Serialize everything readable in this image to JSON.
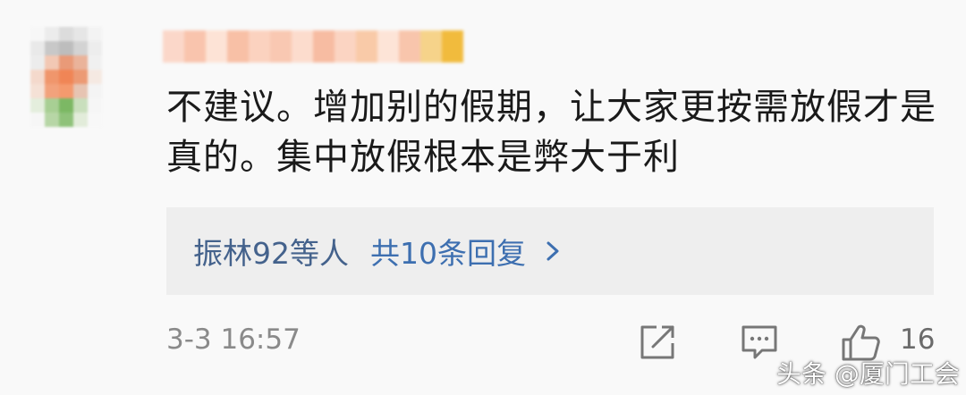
{
  "comment": {
    "text": "不建议。增加别的假期，让大家更按需放假才是真的。集中放假根本是弊大于利"
  },
  "replies": {
    "names": "振林92等人",
    "count_label": "共10条回复"
  },
  "meta": {
    "timestamp": "3-3 16:57",
    "like_count": "16"
  },
  "icons": {
    "share": "share-icon",
    "comment": "comment-icon",
    "like": "thumbs-up-icon",
    "chevron": "chevron-right-icon"
  },
  "watermark": "头条 @厦门工会",
  "colors": {
    "reply_link": "#3d6fb0",
    "reply_names": "#44628c",
    "timestamp": "#8a8a8a",
    "reply_bg": "#eeeeee"
  }
}
